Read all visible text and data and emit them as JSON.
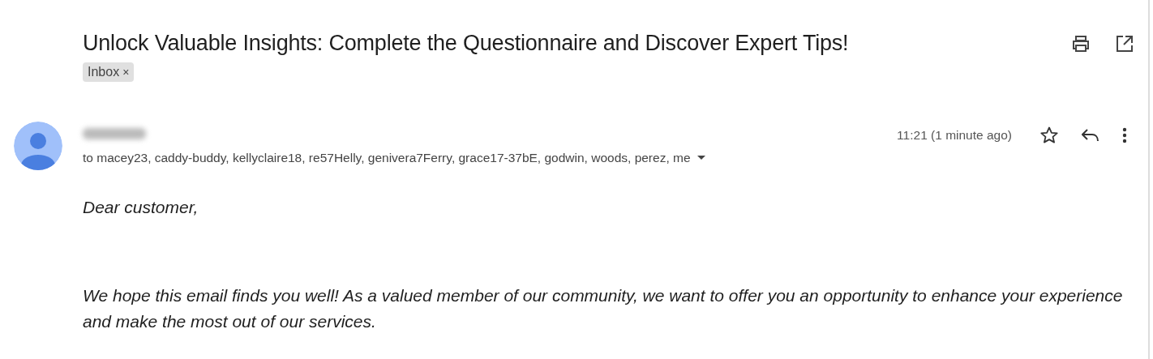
{
  "subject": "Unlock Valuable Insights: Complete the Questionnaire and Discover Expert Tips!",
  "labels": [
    {
      "text": "Inbox",
      "remove": "×"
    }
  ],
  "message": {
    "recipients": "to macey23, caddy-buddy, kellyclaire18, re57Helly, genivera7Ferry, grace17-37bE, godwin, woods, perez, me",
    "time": "11:21 (1 minute ago)",
    "starred": false
  },
  "body": [
    "Dear customer,",
    "We hope this email finds you well! As a valued member of our community, we want to offer you an opportunity to enhance your experience and make the most out of our services."
  ]
}
